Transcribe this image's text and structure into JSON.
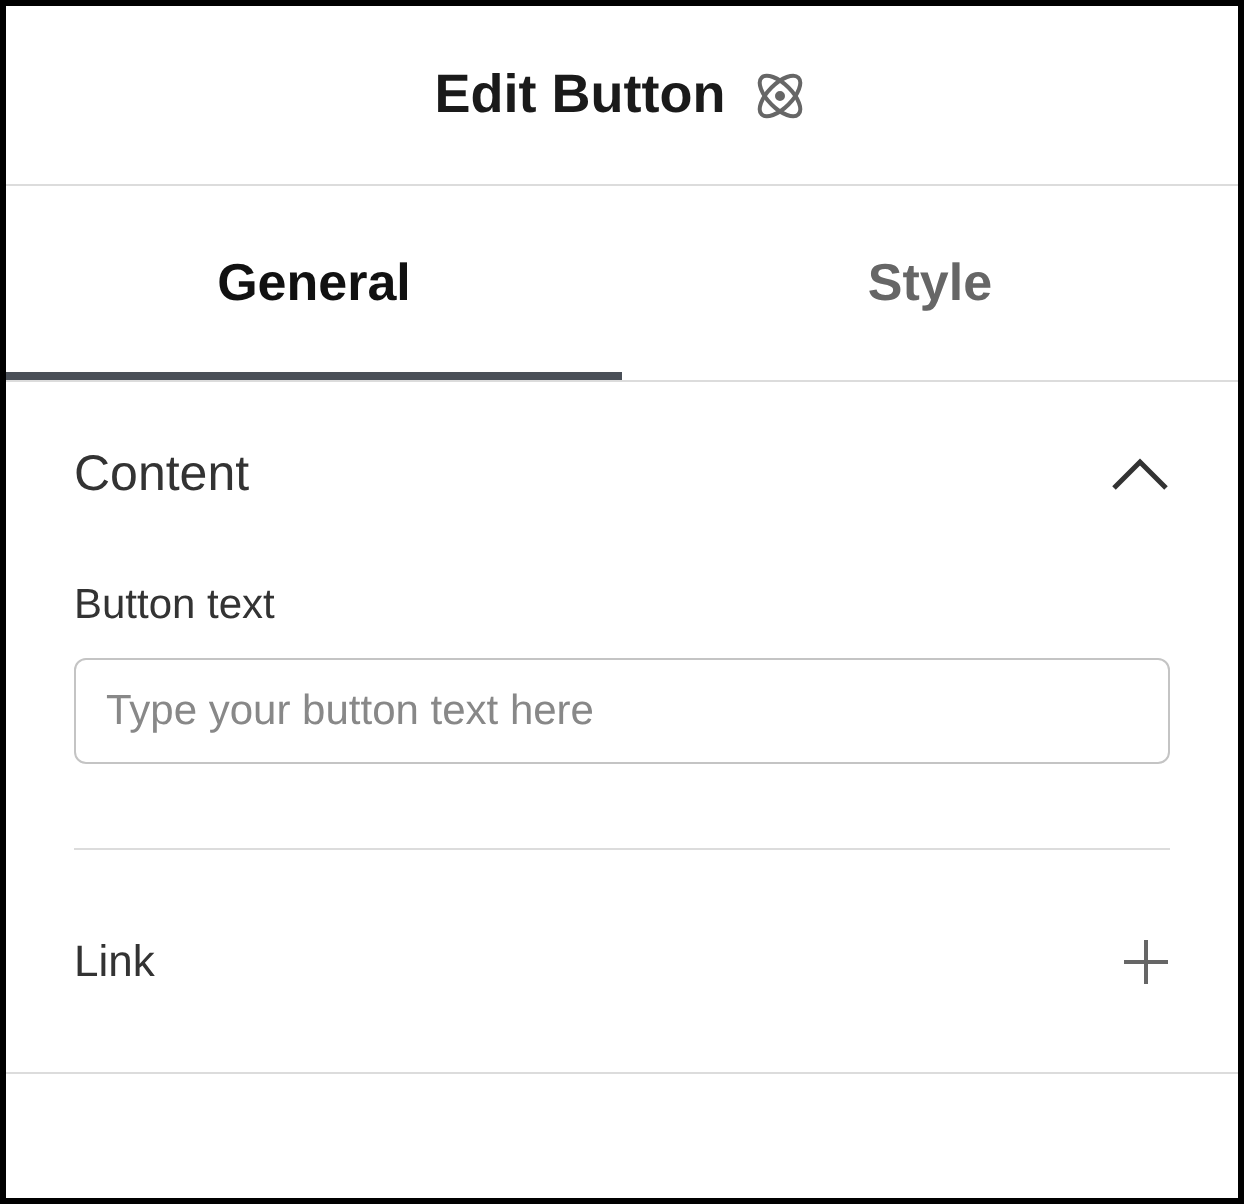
{
  "header": {
    "title": "Edit Button"
  },
  "tabs": [
    {
      "label": "General",
      "selected": true
    },
    {
      "label": "Style",
      "selected": false
    }
  ],
  "section": {
    "title": "Content",
    "expanded": true,
    "field": {
      "label": "Button text",
      "placeholder": "Type your button text here"
    }
  },
  "link": {
    "label": "Link"
  }
}
